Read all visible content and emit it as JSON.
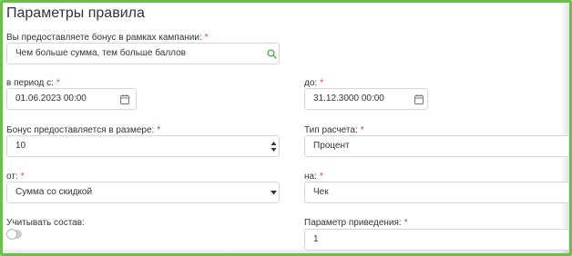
{
  "page": {
    "title": "Параметры правила",
    "required_mark": "*"
  },
  "bonus_scope": {
    "label": "Вы предоставляете бонус в рамках кампании:",
    "value": "Чем больше сумма, тем больше баллов",
    "icon": "search-icon"
  },
  "period_from": {
    "label": "в период с:",
    "value": "01.06.2023 00:00",
    "icon": "calendar-icon"
  },
  "period_to": {
    "label": "до:",
    "value": "31.12.3000 00:00",
    "icon": "calendar-icon"
  },
  "bonus_amount": {
    "label": "Бонус предоставляется в размере:",
    "value": "10"
  },
  "calc_type": {
    "label": "Тип расчета:",
    "value": "Процент"
  },
  "from_base": {
    "label": "от:",
    "value": "Сумма со скидкой"
  },
  "on_target": {
    "label": "на:",
    "value": "Чек"
  },
  "consider_composition": {
    "label": "Учитывать состав:",
    "enabled": false
  },
  "conversion_param": {
    "label": "Параметр приведения:",
    "value": "1"
  },
  "colors": {
    "frame": "#6cc04a",
    "required": "#e03b3b",
    "search_icon": "#4caf50"
  }
}
